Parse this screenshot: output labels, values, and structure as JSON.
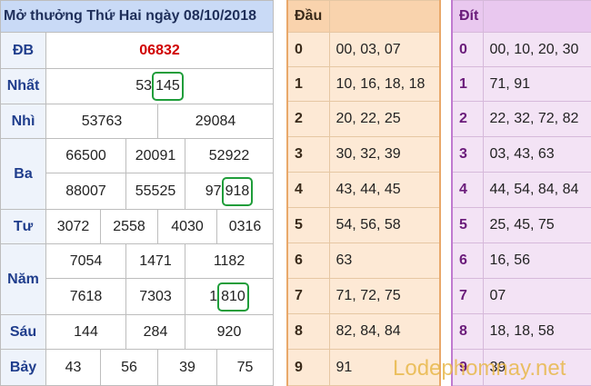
{
  "title": "Mở thưởng Thứ Hai ngày 08/10/2018",
  "prizes": {
    "db": {
      "label": "ĐB",
      "value": "06832"
    },
    "nhat": {
      "label": "Nhất",
      "pre": "53",
      "hl": "145"
    },
    "nhi": {
      "label": "Nhì",
      "values": [
        "53763",
        "29084"
      ]
    },
    "ba": {
      "label": "Ba",
      "row1": [
        "66500",
        "20091",
        "52922"
      ],
      "row2": [
        "88007",
        "55525"
      ],
      "row2_last_pre": "97",
      "row2_last_hl": "918"
    },
    "tu": {
      "label": "Tư",
      "values": [
        "3072",
        "2558",
        "4030",
        "0316"
      ]
    },
    "nam": {
      "label": "Năm",
      "row1": [
        "7054",
        "1471",
        "1182"
      ],
      "row2": [
        "7618",
        "7303"
      ],
      "row2_last_pre": "1",
      "row2_last_hl": "810"
    },
    "sau": {
      "label": "Sáu",
      "values": [
        "144",
        "284",
        "920"
      ]
    },
    "bay": {
      "label": "Bảy",
      "values": [
        "43",
        "56",
        "39",
        "75"
      ]
    }
  },
  "dau": {
    "header": "Đầu",
    "rows": [
      {
        "n": "0",
        "v": "00, 03, 07"
      },
      {
        "n": "1",
        "v": "10, 16, 18, 18"
      },
      {
        "n": "2",
        "v": "20, 22, 25"
      },
      {
        "n": "3",
        "v": "30, 32, 39"
      },
      {
        "n": "4",
        "v": "43, 44, 45"
      },
      {
        "n": "5",
        "v": "54, 56, 58"
      },
      {
        "n": "6",
        "v": "63"
      },
      {
        "n": "7",
        "v": "71, 72, 75"
      },
      {
        "n": "8",
        "v": "82, 84, 84"
      },
      {
        "n": "9",
        "v": "91"
      }
    ]
  },
  "dit": {
    "header": "Đít",
    "rows": [
      {
        "n": "0",
        "v": "00, 10, 20, 30"
      },
      {
        "n": "1",
        "v": "71, 91"
      },
      {
        "n": "2",
        "v": "22, 32, 72, 82"
      },
      {
        "n": "3",
        "v": "03, 43, 63"
      },
      {
        "n": "4",
        "v": "44, 54, 84, 84"
      },
      {
        "n": "5",
        "v": "25, 45, 75"
      },
      {
        "n": "6",
        "v": "16, 56"
      },
      {
        "n": "7",
        "v": "07"
      },
      {
        "n": "8",
        "v": "18, 18, 58"
      },
      {
        "n": "9",
        "v": "39"
      }
    ]
  },
  "watermark": "Lodephomnay.net",
  "colors": {
    "header_blue": "#c9daf6",
    "db_red": "#d00000",
    "highlight_green": "#1f9d3a",
    "dau_orange": "#fde9d5",
    "dit_purple": "#f3e3f5"
  }
}
